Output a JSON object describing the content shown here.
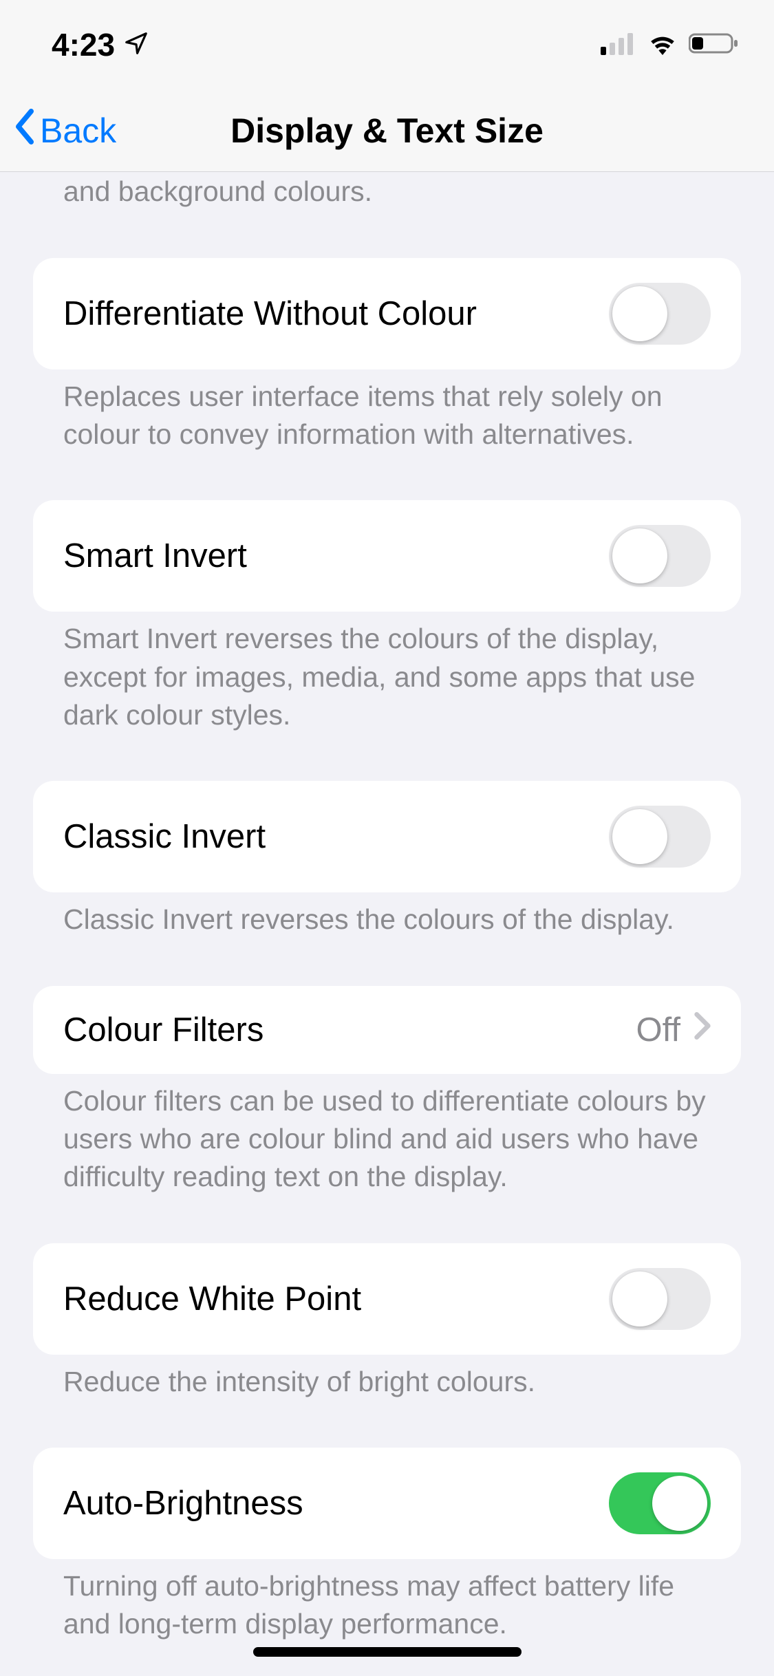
{
  "status": {
    "time": "4:23"
  },
  "nav": {
    "back_label": "Back",
    "title": "Display & Text Size"
  },
  "partial_prev_footer": "Increase colour contrast between app foreground and background colours.",
  "groups": [
    {
      "title": "Differentiate Without Colour",
      "toggle_on": false,
      "footer": "Replaces user interface items that rely solely on colour to convey information with alternatives."
    },
    {
      "title": "Smart Invert",
      "toggle_on": false,
      "footer": "Smart Invert reverses the colours of the display, except for images, media, and some apps that use dark colour styles."
    },
    {
      "title": "Classic Invert",
      "toggle_on": false,
      "footer": "Classic Invert reverses the colours of the display."
    },
    {
      "title": "Colour Filters",
      "value": "Off",
      "nav": true,
      "footer": "Colour filters can be used to differentiate colours by users who are colour blind and aid users who have difficulty reading text on the display."
    },
    {
      "title": "Reduce White Point",
      "toggle_on": false,
      "footer": "Reduce the intensity of bright colours."
    },
    {
      "title": "Auto-Brightness",
      "toggle_on": true,
      "footer": "Turning off auto-brightness may affect battery life and long-term display performance."
    }
  ]
}
